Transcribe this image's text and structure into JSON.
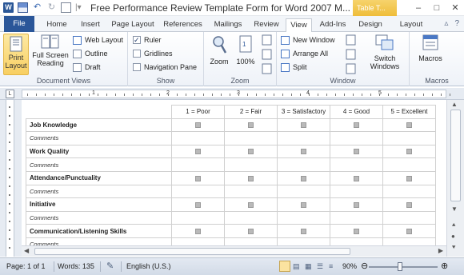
{
  "titlebar": {
    "title": "Free Performance Review Template Form for Word 2007 M...",
    "context_tab": "Table T...",
    "word_icon_letter": "W",
    "min": "–",
    "max": "□",
    "close": "✕"
  },
  "tabs": [
    {
      "label": "File"
    },
    {
      "label": "Home"
    },
    {
      "label": "Insert"
    },
    {
      "label": "Page Layout"
    },
    {
      "label": "References"
    },
    {
      "label": "Mailings"
    },
    {
      "label": "Review"
    },
    {
      "label": "View"
    },
    {
      "label": "Add-Ins"
    },
    {
      "label": "Design"
    },
    {
      "label": "Layout"
    }
  ],
  "ribbon": {
    "document_views": {
      "label": "Document Views",
      "print_layout": "Print Layout",
      "full_screen_reading": "Full Screen Reading",
      "web_layout": "Web Layout",
      "outline": "Outline",
      "draft": "Draft"
    },
    "show": {
      "label": "Show",
      "ruler": "Ruler",
      "gridlines": "Gridlines",
      "navigation_pane": "Navigation Pane",
      "ruler_checked": true,
      "gridlines_checked": false,
      "navigation_checked": false
    },
    "zoom": {
      "label": "Zoom",
      "zoom": "Zoom",
      "hundred": "100%"
    },
    "window": {
      "label": "Window",
      "new_window": "New Window",
      "arrange_all": "Arrange All",
      "split": "Split",
      "switch_windows": "Switch Windows"
    },
    "macros": {
      "label": "Macros",
      "macros": "Macros"
    }
  },
  "ruler_labels": [
    "1",
    "2",
    "3",
    "4",
    "5"
  ],
  "table": {
    "headers": [
      "1 = Poor",
      "2 = Fair",
      "3 = Satisfactory",
      "4 = Good",
      "5 = Excellent"
    ],
    "rows": [
      {
        "label": "Job Knowledge",
        "type": "criterion"
      },
      {
        "label": "Comments",
        "type": "comment"
      },
      {
        "label": "Work Quality",
        "type": "criterion"
      },
      {
        "label": "Comments",
        "type": "comment"
      },
      {
        "label": "Attendance/Punctuality",
        "type": "criterion"
      },
      {
        "label": "Comments",
        "type": "comment"
      },
      {
        "label": "Initiative",
        "type": "criterion"
      },
      {
        "label": "Comments",
        "type": "comment"
      },
      {
        "label": "Communication/Listening Skills",
        "type": "criterion"
      },
      {
        "label": "Comments",
        "type": "comment"
      }
    ]
  },
  "status": {
    "page": "Page: 1 of 1",
    "words": "Words: 135",
    "language": "English (U.S.)",
    "zoom": "90%",
    "zoom_level_percent": 90
  }
}
